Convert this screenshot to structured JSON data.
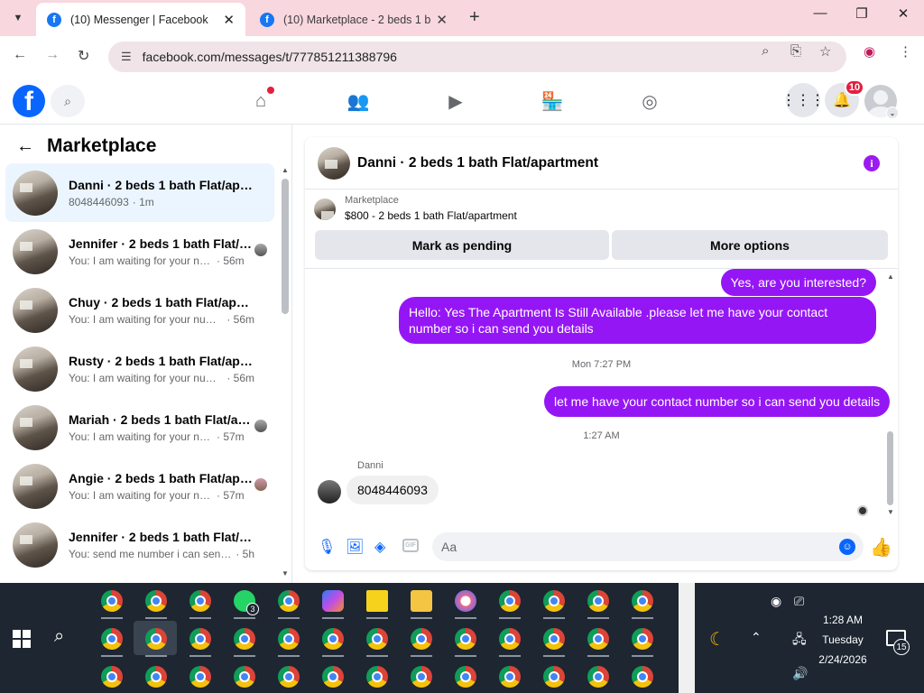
{
  "browser": {
    "tabs": [
      {
        "title": "(10) Messenger | Facebook",
        "active": true
      },
      {
        "title": "(10) Marketplace - 2 beds 1 bat",
        "active": false
      }
    ],
    "url": "facebook.com/messages/t/777851211388796"
  },
  "fb": {
    "notification_count": "10"
  },
  "sidebar": {
    "title": "Marketplace",
    "conversations": [
      {
        "name": "Danni · 2 beds 1 bath Flat/apart...",
        "snippet": "8048446093",
        "time": "· 1m",
        "selected": true
      },
      {
        "name": "Jennifer · 2 beds 1 bath Flat/a...",
        "snippet": "You: I am waiting for your nu...",
        "time": "· 56m"
      },
      {
        "name": "Chuy · 2 beds 1 bath Flat/apart...",
        "snippet": "You: I am waiting for your number",
        "time": "· 56m"
      },
      {
        "name": "Rusty · 2 beds 1 bath Flat/apart...",
        "snippet": "You: I am waiting for your number",
        "time": "· 56m"
      },
      {
        "name": "Mariah · 2 beds 1 bath Flat/ap...",
        "snippet": "You: I am waiting for your nu...",
        "time": "· 57m"
      },
      {
        "name": "Angie · 2 beds 1 bath Flat/apa...",
        "snippet": "You: I am waiting for your nu...",
        "time": "· 57m"
      },
      {
        "name": "Jennifer · 2 beds 1 bath Flat/apa...",
        "snippet": "You: send me number i can send al...",
        "time": "· 5h"
      }
    ]
  },
  "chat": {
    "title": "Danni · 2 beds 1 bath Flat/apartment",
    "marketplace_label": "Marketplace",
    "listing": "$800 - 2 beds 1 bath Flat/apartment",
    "mark_pending": "Mark as pending",
    "more_options": "More options",
    "messages": {
      "m1": "Yes, are you interested?",
      "m2": "Hello: Yes The Apartment Is Still Available .please let me have your contact number so i can send you details",
      "stamp1": "Mon 7:27 PM",
      "m3": "let me have your contact number so i can send you details",
      "stamp2": "1:27 AM",
      "sender": "Danni",
      "m4": "8048446093"
    },
    "composer_placeholder": "Aa"
  },
  "taskbar": {
    "time": "1:28 AM",
    "day": "Tuesday",
    "date": "2/24/2026",
    "whatsapp_badge": "3",
    "notification_count": "15"
  }
}
